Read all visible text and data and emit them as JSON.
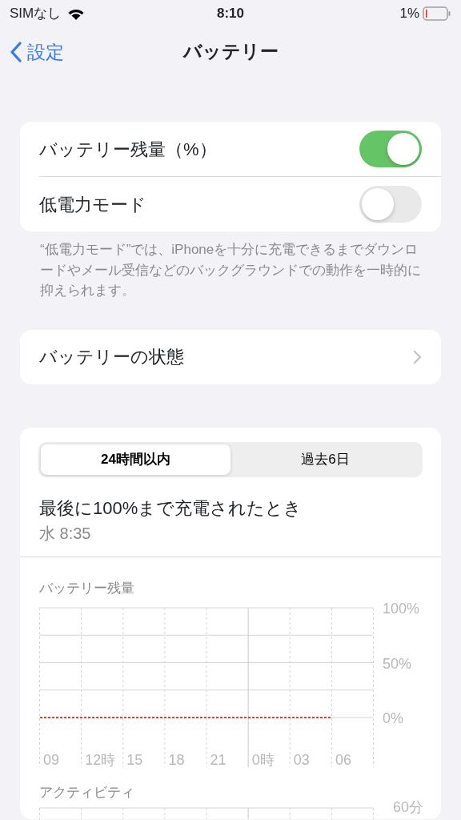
{
  "status_bar": {
    "carrier": "SIMなし",
    "time": "8:10",
    "battery": "1%"
  },
  "nav": {
    "back": "設定",
    "title": "バッテリー"
  },
  "settings": [
    {
      "label": "バッテリー残量（%）",
      "on": true
    },
    {
      "label": "低電力モード",
      "on": false
    }
  ],
  "footer": "“低電力モード”では、iPhoneを十分に充電できるまでダウンロードやメール受信などのバックグラウンドでの動作を一時的に抑えられます。",
  "health": {
    "label": "バッテリーの状態"
  },
  "segments": [
    {
      "label": "24時間以内",
      "selected": true
    },
    {
      "label": "過去6日",
      "selected": false
    }
  ],
  "last_charge": {
    "title": "最後に100%まで充電されたとき",
    "time": "水 8:35"
  },
  "battery_chart": {
    "chart_data": {
      "type": "line",
      "title": "バッテリー残量",
      "categories": [
        "09",
        "12時",
        "15",
        "18",
        "21",
        "0時",
        "03",
        "06"
      ],
      "ylim": [
        0,
        100
      ],
      "ref_lines": [
        {
          "axis": "x",
          "value": "0時"
        }
      ],
      "yticks": [
        {
          "value": 0,
          "label": "0%"
        },
        {
          "value": 50,
          "label": "50%"
        },
        {
          "value": 100,
          "label": "100%"
        }
      ],
      "series": [
        {
          "color": "#d9463e",
          "line_style": "dashed",
          "values": [
            0,
            0,
            0,
            0,
            0,
            0,
            0,
            0
          ]
        }
      ]
    }
  },
  "activity": {
    "title": "アクティビティ",
    "tick": "60分"
  }
}
